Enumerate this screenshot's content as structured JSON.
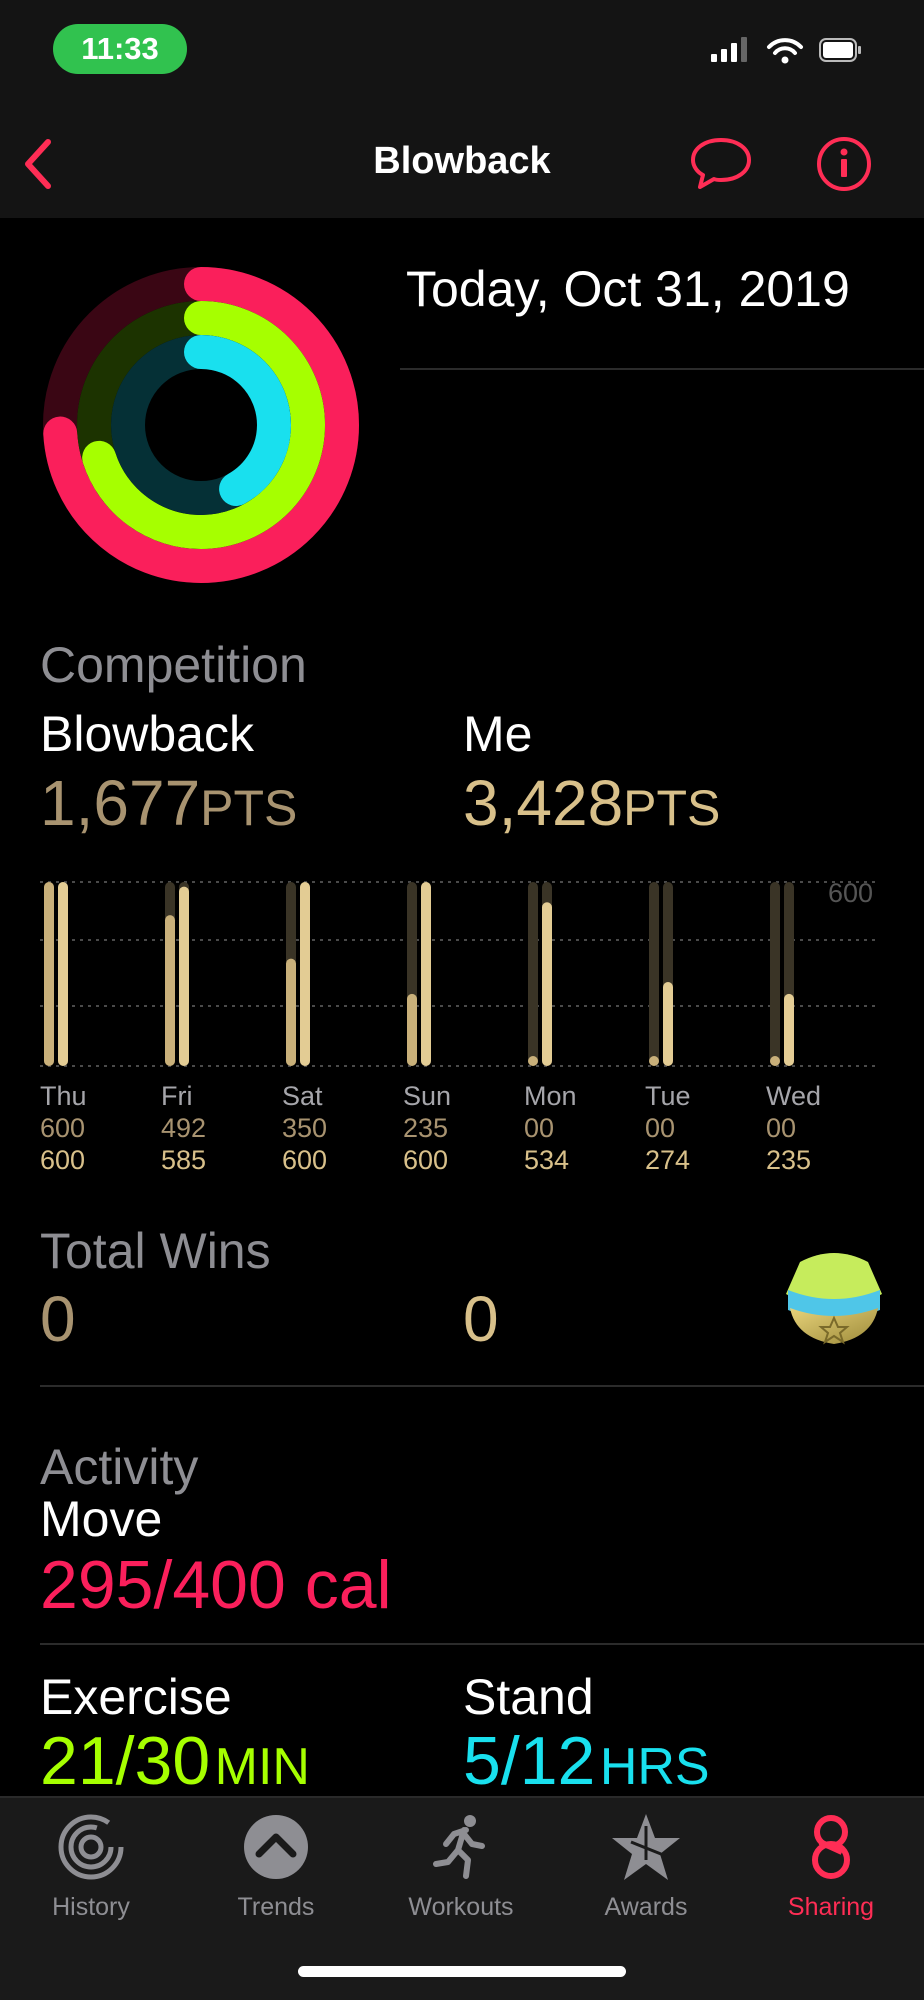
{
  "status": {
    "time": "11:33"
  },
  "nav": {
    "title": "Blowback"
  },
  "date": "Today, Oct 31, 2019",
  "competition": {
    "heading": "Competition",
    "players": [
      {
        "name": "Blowback",
        "points": "1,677",
        "unit": "PTS"
      },
      {
        "name": "Me",
        "points": "3,428",
        "unit": "PTS"
      }
    ],
    "chart_max_label": "600",
    "days": [
      {
        "label": "Thu",
        "blowback": "600",
        "me": "600",
        "b": 600,
        "m": 600
      },
      {
        "label": "Fri",
        "blowback": "492",
        "me": "585",
        "b": 492,
        "m": 585
      },
      {
        "label": "Sat",
        "blowback": "350",
        "me": "600",
        "b": 350,
        "m": 600
      },
      {
        "label": "Sun",
        "blowback": "235",
        "me": "600",
        "b": 235,
        "m": 600
      },
      {
        "label": "Mon",
        "blowback": "00",
        "me": "534",
        "b": 0,
        "m": 534
      },
      {
        "label": "Tue",
        "blowback": "00",
        "me": "274",
        "b": 0,
        "m": 274
      },
      {
        "label": "Wed",
        "blowback": "00",
        "me": "235",
        "b": 0,
        "m": 235
      }
    ]
  },
  "wins": {
    "heading": "Total Wins",
    "blowback": "0",
    "me": "0"
  },
  "activity": {
    "heading": "Activity",
    "move": {
      "label": "Move",
      "value": "295/400 cal",
      "progress": 0.74
    },
    "exercise": {
      "label": "Exercise",
      "value": "21/30",
      "unit": "MIN",
      "progress": 0.7
    },
    "stand": {
      "label": "Stand",
      "value": "5/12",
      "unit": "HRS",
      "progress": 0.42
    }
  },
  "tabs": [
    {
      "label": "History",
      "icon": "history-rings-icon",
      "active": false
    },
    {
      "label": "Trends",
      "icon": "trends-chevron-icon",
      "active": false
    },
    {
      "label": "Workouts",
      "icon": "runner-icon",
      "active": false
    },
    {
      "label": "Awards",
      "icon": "star-award-icon",
      "active": false
    },
    {
      "label": "Sharing",
      "icon": "sharing-icon",
      "active": true
    }
  ],
  "colors": {
    "move": "#fa1f5b",
    "exercise": "#a6ff00",
    "stand": "#19e0ee",
    "gold": "#c9b07a",
    "accent": "#ff2d55"
  }
}
